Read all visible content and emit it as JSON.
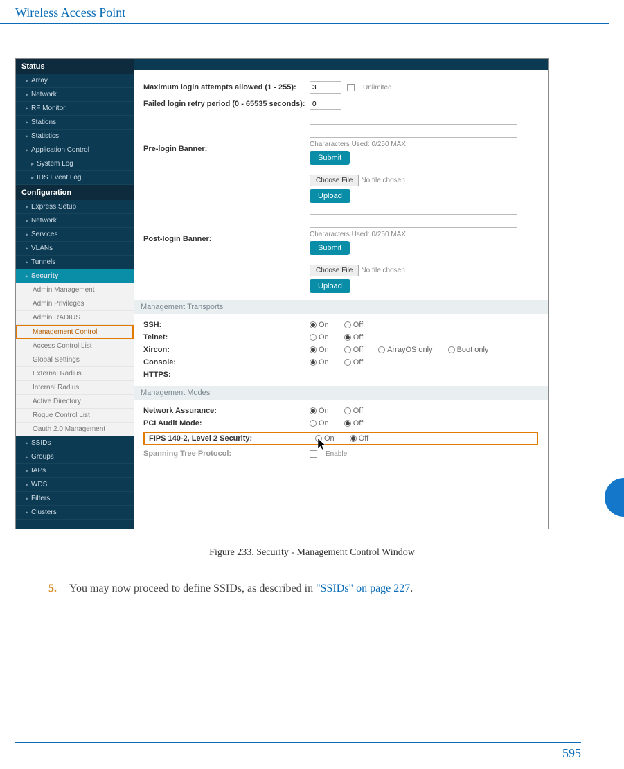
{
  "page": {
    "header": "Wireless Access Point",
    "page_number": "595",
    "caption": "Figure 233.  Security - Management Control Window",
    "step_num": "5.",
    "body_text_pre": "You may now proceed to define SSIDs, as described in ",
    "body_link": "\"SSIDs\" on page 227",
    "body_text_post": "."
  },
  "sidebar": {
    "status_head": "Status",
    "config_head": "Configuration",
    "status_items": [
      "Array",
      "Network",
      "RF Monitor",
      "Stations",
      "Statistics",
      "Application Control",
      "System Log",
      "IDS Event Log"
    ],
    "config_items_top": [
      "Express Setup",
      "Network",
      "Services",
      "VLANs",
      "Tunnels"
    ],
    "security_item": "Security",
    "sub_items_a": [
      "Admin Management",
      "Admin Privileges",
      "Admin RADIUS"
    ],
    "sub_highlight": "Management Control",
    "sub_items_b": [
      "Access Control List",
      "Global Settings",
      "External Radius",
      "Internal Radius",
      "Active Directory",
      "Rogue Control List",
      "Oauth 2.0 Management"
    ],
    "config_items_bottom": [
      "SSIDs",
      "Groups",
      "IAPs",
      "WDS",
      "Filters",
      "Clusters"
    ]
  },
  "form": {
    "max_login_label": "Maximum login attempts allowed (1 - 255):",
    "max_login_value": "3",
    "unlimited_label": "Unlimited",
    "retry_label": "Failed login retry period (0 - 65535 seconds):",
    "retry_value": "0",
    "pre_banner_label": "Pre-login Banner:",
    "post_banner_label": "Post-login Banner:",
    "chars_hint": "Chararacters Used: 0/250 MAX",
    "submit_btn": "Submit",
    "choose_file_btn": "Choose File",
    "no_file": "No file chosen",
    "upload_btn": "Upload",
    "transports_head": "Management Transports",
    "modes_head": "Management Modes",
    "ssh_label": "SSH:",
    "telnet_label": "Telnet:",
    "xircon_label": "Xircon:",
    "console_label": "Console:",
    "https_label": "HTTPS:",
    "on": "On",
    "off": "Off",
    "arrayos": "ArrayOS only",
    "boot_only": "Boot only",
    "net_assurance": "Network Assurance:",
    "pci_audit": "PCI Audit Mode:",
    "fips": "FIPS 140-2, Level 2 Security:",
    "spanning": "Spanning Tree Protocol:",
    "enable": "Enable"
  }
}
